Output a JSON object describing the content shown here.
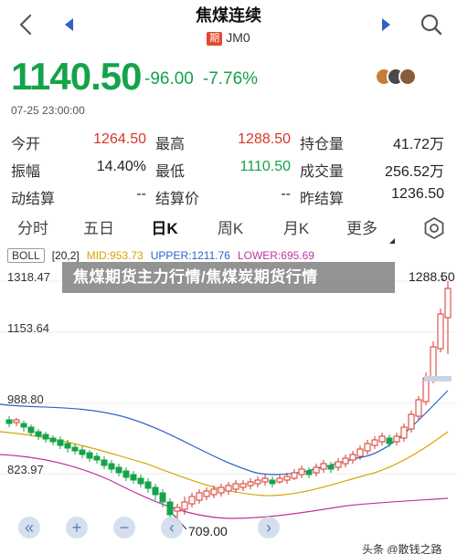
{
  "header": {
    "title": "焦煤连续",
    "tag": "期",
    "code": "JM0"
  },
  "quote": {
    "price": "1140.50",
    "change": "-96.00",
    "change_pct": "-7.76%",
    "timestamp": "07-25 23:00:00"
  },
  "stats": [
    [
      {
        "label": "今开",
        "value": "1264.50",
        "tone": "red"
      },
      {
        "label": "最高",
        "value": "1288.50",
        "tone": "red"
      },
      {
        "label": "持仓量",
        "value": "41.72万",
        "tone": "dark"
      }
    ],
    [
      {
        "label": "振幅",
        "value": "14.40%",
        "tone": "dark"
      },
      {
        "label": "最低",
        "value": "1110.50",
        "tone": "green"
      },
      {
        "label": "成交量",
        "value": "256.52万",
        "tone": "dark"
      }
    ],
    [
      {
        "label": "动结算",
        "value": "--",
        "tone": "dark"
      },
      {
        "label": "结算价",
        "value": "--",
        "tone": "dark"
      },
      {
        "label": "昨结算",
        "value": "1236.50",
        "tone": "dark"
      }
    ]
  ],
  "tabs": [
    "分时",
    "五日",
    "日K",
    "周K",
    "月K",
    "更多"
  ],
  "active_tab": "日K",
  "legend": {
    "indicator": "BOLL",
    "params": "[20,2]",
    "mid": "MID:953.73",
    "upper": "UPPER:1211.76",
    "lower": "LOWER:695.69"
  },
  "axis": {
    "y1": "1318.47",
    "y2": "1153.64",
    "y3": "988.80",
    "y4": "823.97"
  },
  "banner": "焦煤期货主力行情/焦煤炭期货行情",
  "markers": {
    "high": "1288.50",
    "low": "709.00"
  },
  "watermark": "头条 @散钱之路",
  "colors": {
    "up": "#d8352a",
    "down": "#15a34a",
    "mid": "#d8a400",
    "upper": "#2d62c8",
    "lower": "#c0349e",
    "accent": "#3b6fd1"
  },
  "icons": [
    "back-icon",
    "prev-icon",
    "next-icon",
    "search-icon",
    "settings-icon",
    "collapse-icon",
    "zoom-in-icon",
    "zoom-out-icon",
    "pan-left-icon",
    "pan-right-icon"
  ]
}
